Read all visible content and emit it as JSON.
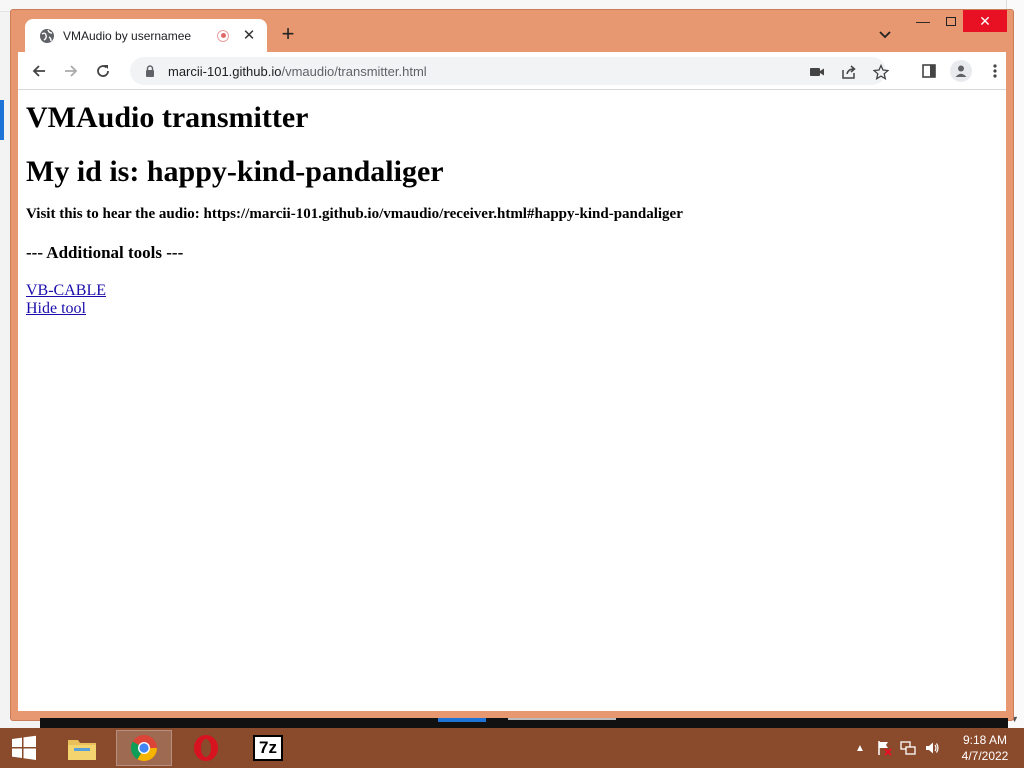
{
  "browser": {
    "tab_title": "VMAudio by usernamee",
    "tab_close": "✕",
    "new_tab": "+",
    "url_host": "marcii-101.github.io",
    "url_path": "/vmaudio/transmitter.html"
  },
  "page": {
    "heading": "VMAudio transmitter",
    "id_line": "My id is: happy-kind-pandaliger",
    "visit_line": "Visit this to hear the audio: https://marcii-101.github.io/vmaudio/receiver.html#happy-kind-pandaliger",
    "tools_heading": "--- Additional tools ---",
    "links": [
      "VB-CABLE",
      "Hide tool"
    ]
  },
  "taskbar": {
    "apps": [
      "file-explorer",
      "chrome",
      "opera",
      "7-zip"
    ],
    "sevenzip_label": "7z",
    "clock_time": "9:18 AM",
    "clock_date": "4/7/2022"
  },
  "colors": {
    "window_frame": "#e89870",
    "taskbar": "#8a4a2c",
    "link": "#1a0dab",
    "close_button": "#e81123"
  }
}
